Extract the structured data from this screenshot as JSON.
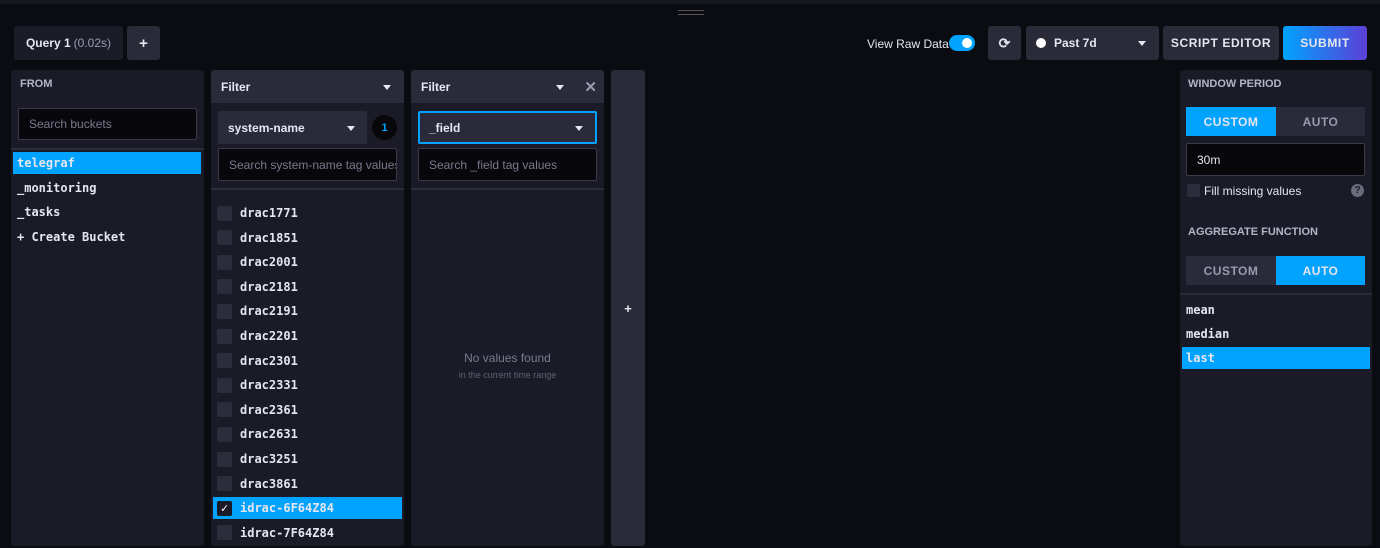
{
  "query_tab": {
    "label": "Query 1",
    "time": "(0.02s)"
  },
  "add_query_label": "+",
  "toolbar": {
    "raw_data_label": "View Raw Data",
    "raw_data_on": true,
    "time_range": "Past 7d",
    "script_editor": "SCRIPT EDITOR",
    "submit": "SUBMIT"
  },
  "from": {
    "title": "FROM",
    "search_placeholder": "Search buckets",
    "buckets": [
      "telegraf",
      "_monitoring",
      "_tasks",
      "+ Create Bucket"
    ],
    "selected": "telegraf"
  },
  "filter1": {
    "title": "Filter",
    "key": "system-name",
    "count": "1",
    "search_placeholder": "Search system-name tag values",
    "values": [
      {
        "label": "drac1771",
        "checked": false
      },
      {
        "label": "drac1851",
        "checked": false
      },
      {
        "label": "drac2001",
        "checked": false
      },
      {
        "label": "drac2181",
        "checked": false
      },
      {
        "label": "drac2191",
        "checked": false
      },
      {
        "label": "drac2201",
        "checked": false
      },
      {
        "label": "drac2301",
        "checked": false
      },
      {
        "label": "drac2331",
        "checked": false
      },
      {
        "label": "drac2361",
        "checked": false
      },
      {
        "label": "drac2631",
        "checked": false
      },
      {
        "label": "drac3251",
        "checked": false
      },
      {
        "label": "drac3861",
        "checked": false
      },
      {
        "label": "idrac-6F64Z84",
        "checked": true
      },
      {
        "label": "idrac-7F64Z84",
        "checked": false
      }
    ]
  },
  "filter2": {
    "title": "Filter",
    "key": "_field",
    "search_placeholder": "Search _field tag values",
    "empty_title": "No values found",
    "empty_sub": "in the current time range"
  },
  "add_filter_label": "+",
  "window": {
    "title": "WINDOW PERIOD",
    "custom": "CUSTOM",
    "auto": "AUTO",
    "active": "CUSTOM",
    "value": "30m",
    "fill_missing": "Fill missing values",
    "fill_checked": false,
    "help": "?"
  },
  "aggregate": {
    "title": "AGGREGATE FUNCTION",
    "custom": "CUSTOM",
    "auto": "AUTO",
    "active": "AUTO",
    "functions": [
      "mean",
      "median",
      "last"
    ],
    "selected": "last"
  },
  "colors": {
    "accent": "#00a3ff",
    "submit_end": "#5b3fd6"
  }
}
